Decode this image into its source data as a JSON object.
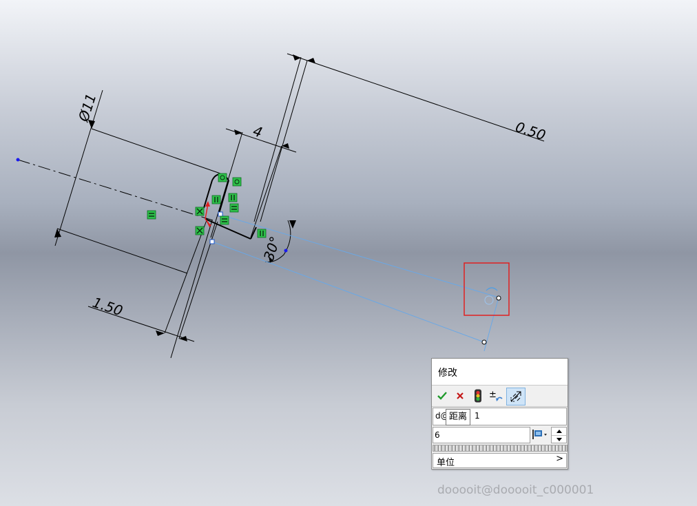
{
  "sketch": {
    "dimensions": {
      "diameter": "Ø11",
      "width": "4",
      "offset": "0.50",
      "length": "1.50",
      "angle": "30°"
    },
    "highlight_color": "#e02020",
    "construction_color": "#4a9ee8",
    "relation_color": "#2ec04a"
  },
  "modify_dialog": {
    "title": "修改",
    "toolbar": {
      "ok_icon": "checkmark-icon",
      "cancel_icon": "x-icon",
      "rebuild_icon": "traffic-light-icon",
      "reverse_icon": "plus-minus-icon",
      "mark_driven_icon": "dimension-marker-icon"
    },
    "dimension_name": "d@",
    "dimension_suffix": "1",
    "tooltip": "距离",
    "value": "6",
    "units_label": "单位",
    "units_arrow": ">"
  },
  "watermark": "dooooit@dooooit_c000001"
}
